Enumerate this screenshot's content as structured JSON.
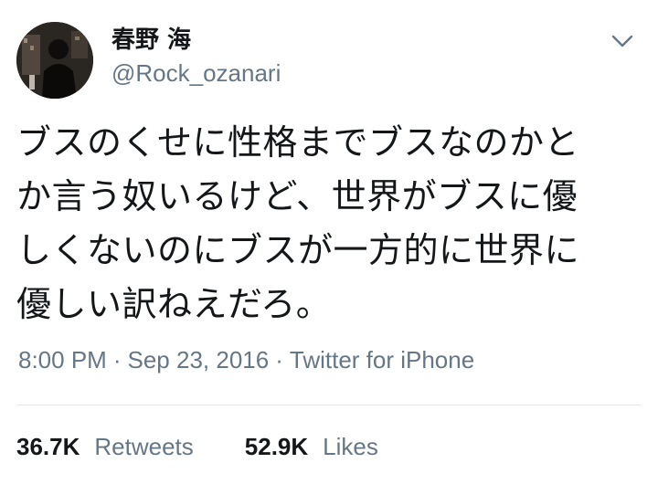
{
  "user": {
    "display_name": "春野 海",
    "handle": "@Rock_ozanari",
    "avatar_icon": "user-avatar-photo"
  },
  "menu": {
    "icon": "chevron-down-icon"
  },
  "tweet": {
    "lines": [
      "ブスのくせに性格までブスなのかと",
      "か言う奴いるけど、世界がブスに優",
      "しくないのにブスが一方的に世界に",
      "優しい訳ねえだろ。"
    ]
  },
  "meta": {
    "time": "8:00 PM",
    "date": "Sep 23, 2016",
    "source": "Twitter for iPhone",
    "separator": "·"
  },
  "stats": {
    "retweets_count": "36.7K",
    "retweets_label": "Retweets",
    "likes_count": "52.9K",
    "likes_label": "Likes"
  },
  "colors": {
    "text_primary": "#14171a",
    "text_secondary": "#657786",
    "divider": "#e1e8ed",
    "background": "#ffffff"
  }
}
